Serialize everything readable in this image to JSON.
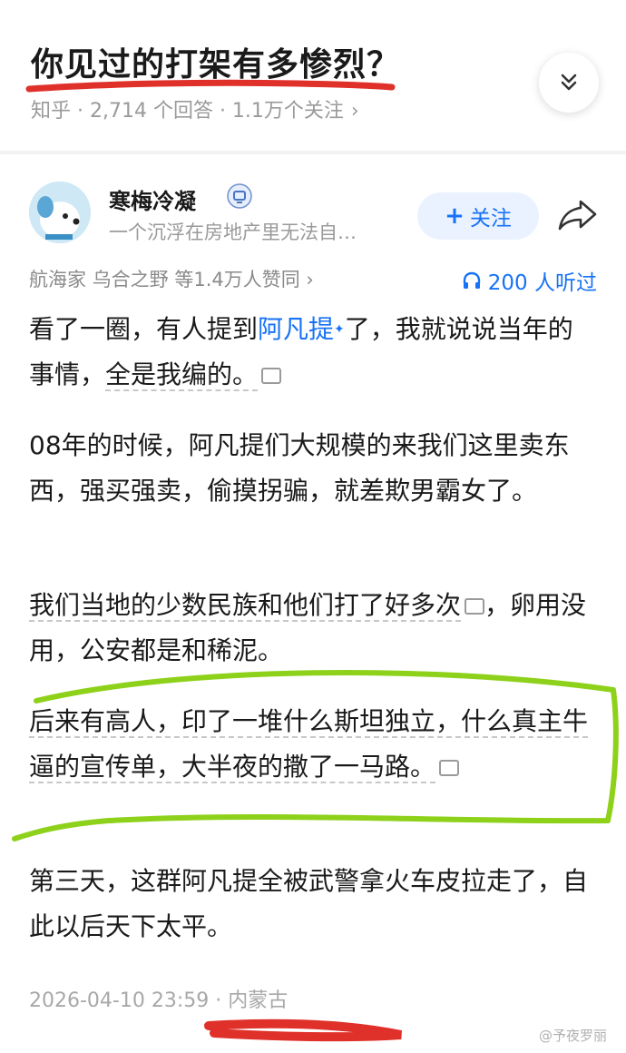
{
  "question": {
    "title": "你见过的打架有多惨烈？",
    "meta": "知乎 · 2,714 个回答 · 1.1万个关注",
    "meta_chevron": "›"
  },
  "author": {
    "name": "寒梅冷凝",
    "bio": "一个沉浮在房地产里无法自…",
    "follow_label": "关注"
  },
  "stats": {
    "upvotes": "航海家 乌合之野 等1.4万人赞同 ›",
    "listen": "200 人听过"
  },
  "answer": {
    "p1_a": "看了一圈，有人提到",
    "p1_link": "阿凡提",
    "p1_b": "了，我就说说当年的事情，",
    "p1_c": "全是我编的。",
    "p2": "08年的时候，阿凡提们大规模的来我们这里卖东西，强买强卖，偷摸拐骗，就差欺男霸女了。",
    "p3_a": "我们当地的少数民族和他们打了好多次",
    "p3_b": "，卵用没用，公安都是和稀泥。",
    "p4": "后来有高人，印了一堆什么斯坦独立，什么真主牛逼的宣传单，大半夜的撒了一马路。",
    "p5": "第三天，这群阿凡提全被武警拿火车皮拉走了，自此以后天下太平。"
  },
  "footer": {
    "time_location": "2026-04-10 23:59 · 内蒙古",
    "watermark": "@予夜罗丽"
  },
  "colors": {
    "accent": "#1772f6",
    "red_mark": "#e0302a",
    "green_mark": "#8ed11a"
  }
}
